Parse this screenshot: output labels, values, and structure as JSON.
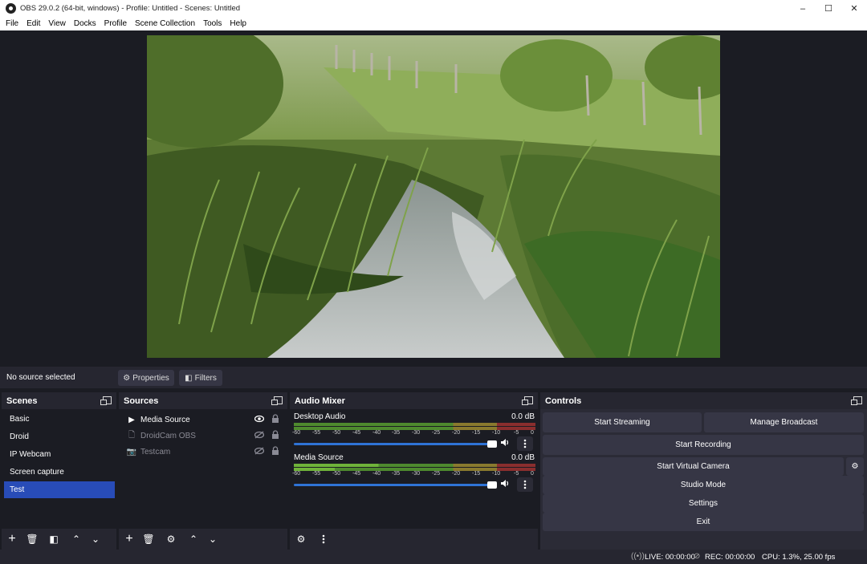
{
  "window": {
    "title": "OBS 29.0.2 (64-bit, windows) - Profile: Untitled - Scenes: Untitled",
    "minimize": "–",
    "maximize": "☐",
    "close": "✕"
  },
  "menu": [
    "File",
    "Edit",
    "View",
    "Docks",
    "Profile",
    "Scene Collection",
    "Tools",
    "Help"
  ],
  "source_toolbar": {
    "status": "No source selected",
    "properties": "Properties",
    "filters": "Filters"
  },
  "scenes": {
    "title": "Scenes",
    "items": [
      "Basic",
      "Droid",
      "IP Webcam",
      "Screen capture",
      "Test"
    ],
    "selected": "Test"
  },
  "sources": {
    "title": "Sources",
    "items": [
      {
        "name": "Media Source",
        "icon": "play-icon",
        "visible": true,
        "locked": true
      },
      {
        "name": "DroidCam OBS",
        "icon": "file-icon",
        "visible": false,
        "locked": true
      },
      {
        "name": "Testcam",
        "icon": "camera-icon",
        "visible": false,
        "locked": true
      }
    ]
  },
  "mixer": {
    "title": "Audio Mixer",
    "ticks": [
      "-60",
      "-55",
      "-50",
      "-45",
      "-40",
      "-35",
      "-30",
      "-25",
      "-20",
      "-15",
      "-10",
      "-5",
      "0"
    ],
    "channels": [
      {
        "name": "Desktop Audio",
        "db": "0.0 dB",
        "volume": 1.0
      },
      {
        "name": "Media Source",
        "db": "0.0 dB",
        "volume": 1.0
      }
    ]
  },
  "controls": {
    "title": "Controls",
    "start_streaming": "Start Streaming",
    "manage_broadcast": "Manage Broadcast",
    "start_recording": "Start Recording",
    "start_virtual_camera": "Start Virtual Camera",
    "studio_mode": "Studio Mode",
    "settings": "Settings",
    "exit": "Exit"
  },
  "status": {
    "live": "LIVE: 00:00:00",
    "rec": "REC: 00:00:00",
    "cpu": "CPU: 1.3%, 25.00 fps"
  },
  "colors": {
    "accent": "#284cb8",
    "fader": "#2f73d6",
    "meter_green": "#4e8a2e",
    "meter_yellow": "#8a7a2e",
    "meter_red": "#8a2e2e"
  }
}
